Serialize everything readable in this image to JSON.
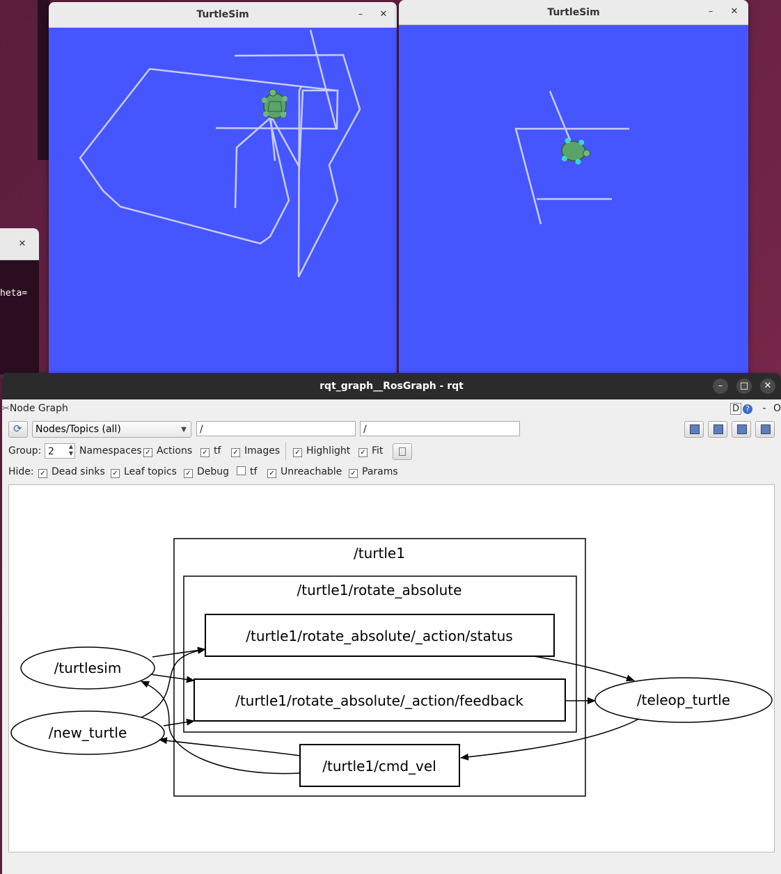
{
  "turtlesim1": {
    "title": "TurtleSim",
    "minimize": "–",
    "close": "✕"
  },
  "turtlesim2": {
    "title": "TurtleSim",
    "minimize": "–",
    "close": "✕"
  },
  "terminal": {
    "close": "✕",
    "text": "heta="
  },
  "rqt": {
    "title": "rqt_graph__RosGraph - rqt",
    "minimize": "–",
    "maximize": "□",
    "close": "✕",
    "plugin_title": "Node Graph",
    "plugin_controls": {
      "d": "D",
      "help": "?",
      "dash": "-",
      "o": "O"
    },
    "toolbar": {
      "mode": "Nodes/Topics (all)",
      "filter1": "/",
      "filter2": "/",
      "group_label": "Group:",
      "group_value": "2",
      "namespaces": "Namespaces",
      "actions": "Actions",
      "tf": "tf",
      "images": "Images",
      "highlight": "Highlight",
      "fit": "Fit"
    },
    "hide": {
      "label": "Hide:",
      "dead_sinks": "Dead sinks",
      "leaf_topics": "Leaf topics",
      "debug": "Debug",
      "tf": "tf",
      "unreachable": "Unreachable",
      "params": "Params"
    },
    "checks": {
      "namespaces": true,
      "actions": true,
      "tf": true,
      "images": true,
      "highlight": true,
      "fit": true,
      "dead_sinks": true,
      "leaf_topics": true,
      "debug": true,
      "hide_tf": false,
      "unreachable": true,
      "params": true
    },
    "graph": {
      "cluster_outer": "/turtle1",
      "cluster_inner": "/turtle1/rotate_absolute",
      "topic_status": "/turtle1/rotate_absolute/_action/status",
      "topic_feedback": "/turtle1/rotate_absolute/_action/feedback",
      "topic_cmd_vel": "/turtle1/cmd_vel",
      "node_turtlesim": "/turtlesim",
      "node_new_turtle": "/new_turtle",
      "node_teleop": "/teleop_turtle"
    }
  }
}
